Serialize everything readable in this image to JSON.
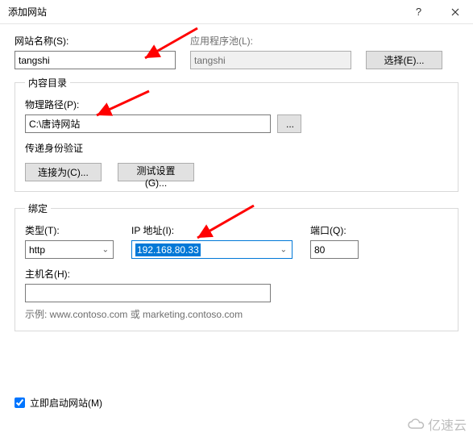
{
  "titlebar": {
    "title": "添加网站"
  },
  "labels": {
    "site_name": "网站名称(S):",
    "app_pool": "应用程序池(L):",
    "select_btn": "选择(E)...",
    "content_dir": "内容目录",
    "physical_path": "物理路径(P):",
    "auth_title": "传递身份验证",
    "connect_as": "连接为(C)...",
    "test_settings": "测试设置(G)...",
    "binding": "绑定",
    "type": "类型(T):",
    "ip_address": "IP 地址(I):",
    "port": "端口(Q):",
    "hostname": "主机名(H):",
    "example": "示例: www.contoso.com 或 marketing.contoso.com",
    "start_site": "立即启动网站(M)"
  },
  "values": {
    "site_name": "tangshi",
    "app_pool": "tangshi",
    "physical_path": "C:\\唐诗网站",
    "type": "http",
    "ip_address": "192.168.80.33",
    "port": "80",
    "hostname": "",
    "start_checked": true
  },
  "watermark": "亿速云"
}
